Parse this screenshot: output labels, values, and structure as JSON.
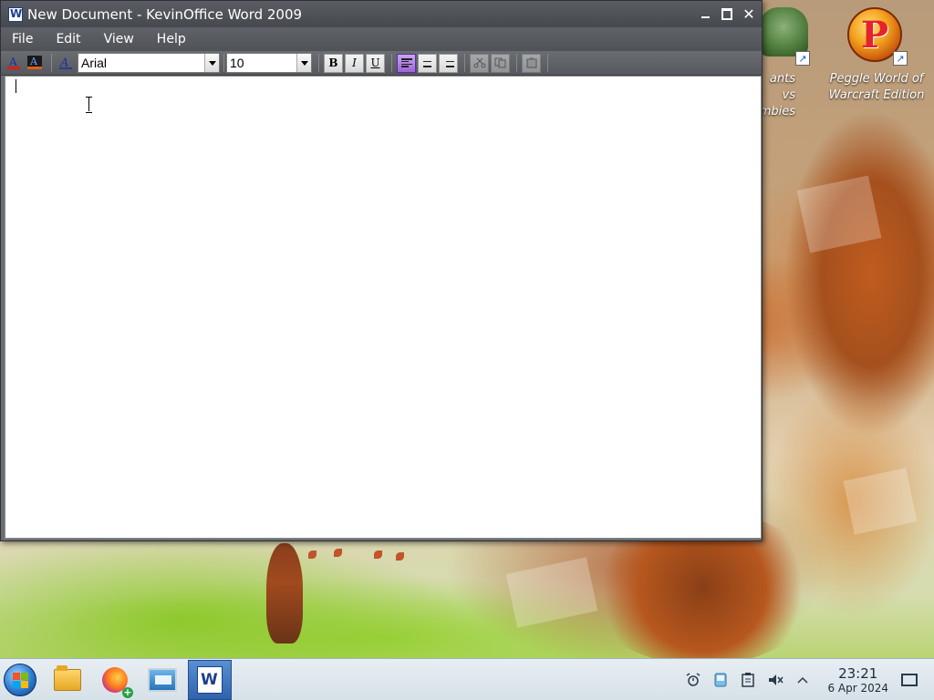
{
  "window": {
    "title": "New Document - KevinOffice Word 2009"
  },
  "menubar": {
    "items": [
      "File",
      "Edit",
      "View",
      "Help"
    ]
  },
  "toolbar": {
    "font_family": "Arial",
    "font_size": "10",
    "bold_label": "B",
    "italic_label": "I",
    "underline_label": "U"
  },
  "desktop": {
    "icons": [
      {
        "label_line1": "ants vs",
        "label_line2": "mbies"
      },
      {
        "label_line1": "Peggle World of",
        "label_line2": "Warcraft Edition"
      }
    ]
  },
  "taskbar": {
    "clock_time": "23:21",
    "clock_date": "6 Apr 2024",
    "apps": [
      "file-manager",
      "firefox",
      "system-monitor",
      "kevinoffice-word"
    ]
  }
}
